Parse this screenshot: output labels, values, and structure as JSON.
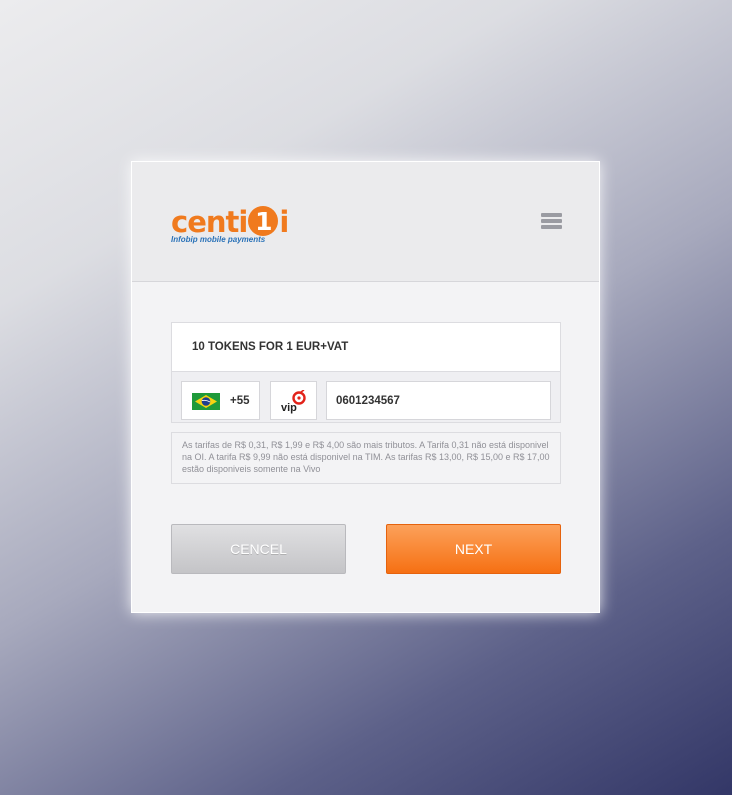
{
  "brand": {
    "name_part1": "centi",
    "name_digit": "1",
    "name_part2": "i",
    "tagline": "Infobip mobile payments",
    "color": "#f07a1e"
  },
  "header": {
    "menu_icon": "hamburger-menu-icon"
  },
  "offer": {
    "label": "10 TOKENS FOR 1 EUR+VAT"
  },
  "phone": {
    "country_flag": "brazil-flag",
    "country_code": "+55",
    "operator": "vip",
    "number": "0601234567"
  },
  "info": {
    "text": "As tarifas de R$ 0,31, R$ 1,99 e R$ 4,00 são mais tributos. A Tarifa 0,31 não está disponivel na OI. A tarifa R$ 9,99 não está disponivel na TIM. As tarifas R$ 13,00, R$ 15,00 e R$ 17,00 estão disponiveis somente na Vivo"
  },
  "buttons": {
    "cancel_label": "CENCEL",
    "next_label": "NEXT"
  },
  "colors": {
    "accent": "#f67013",
    "cancel_gray": "#c4c4c7"
  }
}
